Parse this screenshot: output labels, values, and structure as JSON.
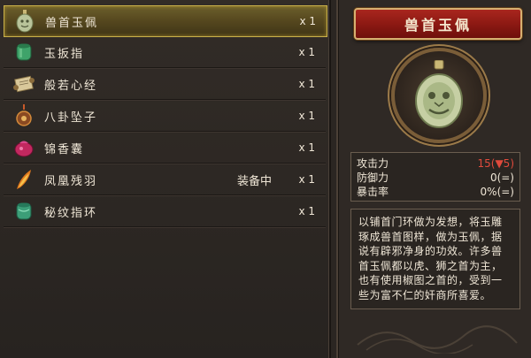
{
  "inventory": {
    "items": [
      {
        "name": "兽首玉佩",
        "icon": "jade-beast-pendant-icon",
        "equipped": "",
        "qty": "x 1",
        "selected": true
      },
      {
        "name": "玉扳指",
        "icon": "jade-thumb-ring-icon",
        "equipped": "",
        "qty": "x 1"
      },
      {
        "name": "般若心经",
        "icon": "scroll-icon",
        "equipped": "",
        "qty": "x 1"
      },
      {
        "name": "八卦坠子",
        "icon": "bagua-pendant-icon",
        "equipped": "",
        "qty": "x 1"
      },
      {
        "name": "锦香囊",
        "icon": "sachet-icon",
        "equipped": "",
        "qty": "x 1"
      },
      {
        "name": "凤凰残羽",
        "icon": "phoenix-feather-icon",
        "equipped": "装备中",
        "qty": "x 1"
      },
      {
        "name": "秘纹指环",
        "icon": "jade-ring-icon",
        "equipped": "",
        "qty": "x 1"
      }
    ]
  },
  "detail": {
    "title": "兽首玉佩",
    "portrait_icon": "jade-beast-pendant-icon",
    "stats": [
      {
        "label": "攻击力",
        "value": "15(▼5)",
        "highlight": true
      },
      {
        "label": "防御力",
        "value": "0(=)"
      },
      {
        "label": "暴击率",
        "value": "0%(=)"
      }
    ],
    "description": "以铺首门环做为发想，将玉雕琢成兽首图样，做为玉佩，据说有辟邪净身的功效。许多兽首玉佩都以虎、狮之首为主，也有使用椒图之首的，受到一些为富不仁的奸商所喜爱。"
  },
  "colors": {
    "selected_row": "#57491f",
    "title_plaque": "#8a1812",
    "stat_highlight": "#e04a3c"
  }
}
